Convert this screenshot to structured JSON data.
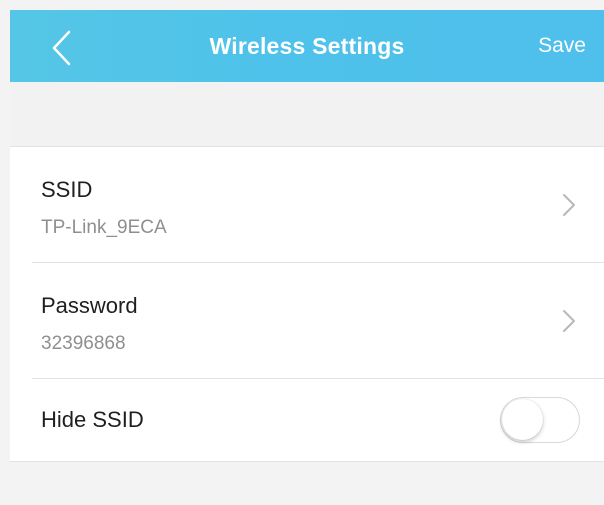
{
  "header": {
    "title": "Wireless Settings",
    "save_label": "Save",
    "back_icon": "chevron-left-icon",
    "background_color": "#4ec2ea"
  },
  "settings": {
    "ssid": {
      "label": "SSID",
      "value": "TP-Link_9ECA",
      "icon": "chevron-right-icon"
    },
    "password": {
      "label": "Password",
      "value": "32396868",
      "icon": "chevron-right-icon"
    },
    "hide_ssid": {
      "label": "Hide SSID",
      "enabled": false
    }
  }
}
